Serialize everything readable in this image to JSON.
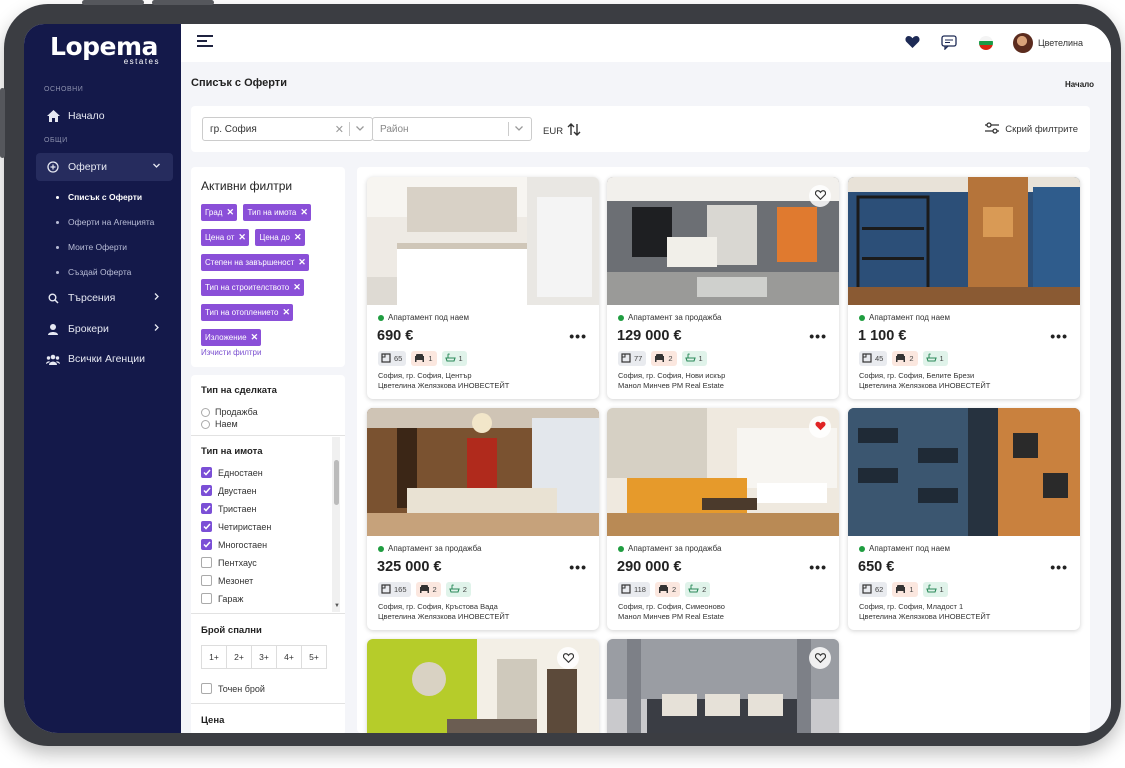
{
  "brand": {
    "name": "Lopema",
    "sub": "estates"
  },
  "sidebar": {
    "section_main": "ОСНОВНИ",
    "section_general": "ОБЩИ",
    "home": "Начало",
    "offers": "Оферти",
    "sub_items": [
      "Списък с Оферти",
      "Оферти на Агенцията",
      "Моите Оферти",
      "Създай Оферта"
    ],
    "searches": "Търсения",
    "brokers": "Брокери",
    "agencies": "Всички Агенции"
  },
  "topbar": {
    "user_name": "Цветелина"
  },
  "page": {
    "title": "Списък с Оферти",
    "breadcrumb": "Начало"
  },
  "filterbar": {
    "city_value": "гр. София",
    "district_placeholder": "Район",
    "currency": "EUR",
    "hide_filters": "Скрий филтрите"
  },
  "active_filters": {
    "title": "Активни филтри",
    "chips": [
      "Град",
      "Тип на имота",
      "Цена от",
      "Цена до",
      "Степен на завършеност",
      "Тип на строителството",
      "Тип на отоплението",
      "Изложение"
    ],
    "clear": "Изчисти филтри"
  },
  "filters": {
    "deal_type_title": "Тип на сделката",
    "deal_types": [
      "Продажба",
      "Наем"
    ],
    "property_type_title": "Тип на имота",
    "property_types": [
      {
        "label": "Едностаен",
        "checked": true
      },
      {
        "label": "Двустаен",
        "checked": true
      },
      {
        "label": "Тристаен",
        "checked": true
      },
      {
        "label": "Четиристаен",
        "checked": true
      },
      {
        "label": "Многостаен",
        "checked": true
      },
      {
        "label": "Пентхаус",
        "checked": false
      },
      {
        "label": "Мезонет",
        "checked": false
      },
      {
        "label": "Гараж",
        "checked": false
      }
    ],
    "bedrooms_title": "Брой спални",
    "bedrooms": [
      "1+",
      "2+",
      "3+",
      "4+",
      "5+"
    ],
    "exact_count": "Точен брой",
    "price_title": "Цена"
  },
  "listings": [
    {
      "status": "Апартамент под наем",
      "price": "690 €",
      "area": "65",
      "beds": "1",
      "baths": "1",
      "location": "София, гр. София, Център",
      "agent": "Цветелина Желязкова ИНОВЕСТЕЙТ",
      "favorite": false,
      "fav_shown": false
    },
    {
      "status": "Апартамент за продажба",
      "price": "129 000 €",
      "area": "77",
      "beds": "2",
      "baths": "1",
      "location": "София, гр. София, Нови искър",
      "agent": "Манол Минчев PM Real Estate",
      "favorite": false,
      "fav_shown": true
    },
    {
      "status": "Апартамент под наем",
      "price": "1 100 €",
      "area": "45",
      "beds": "2",
      "baths": "1",
      "location": "София, гр. София, Белите Брези",
      "agent": "Цветелина Желязкова ИНОВЕСТЕЙТ",
      "favorite": false,
      "fav_shown": false
    },
    {
      "status": "Апартамент за продажба",
      "price": "325 000 €",
      "area": "165",
      "beds": "2",
      "baths": "2",
      "location": "София, гр. София, Кръстова Вада",
      "agent": "Цветелина Желязкова ИНОВЕСТЕЙТ",
      "favorite": false,
      "fav_shown": false
    },
    {
      "status": "Апартамент за продажба",
      "price": "290 000 €",
      "area": "118",
      "beds": "2",
      "baths": "2",
      "location": "София, гр. София, Симеоново",
      "agent": "Манол Минчев PM Real Estate",
      "favorite": true,
      "fav_shown": true
    },
    {
      "status": "Апартамент под наем",
      "price": "650 €",
      "area": "62",
      "beds": "1",
      "baths": "1",
      "location": "София, гр. София, Младост 1",
      "agent": "Цветелина Желязкова ИНОВЕСТЕЙТ",
      "favorite": false,
      "fav_shown": false
    }
  ],
  "colors": {
    "sidebar_bg": "#14194a",
    "chip": "#8a4fd8",
    "status_dot": "#1f9d40",
    "fav_active": "#e02424"
  }
}
